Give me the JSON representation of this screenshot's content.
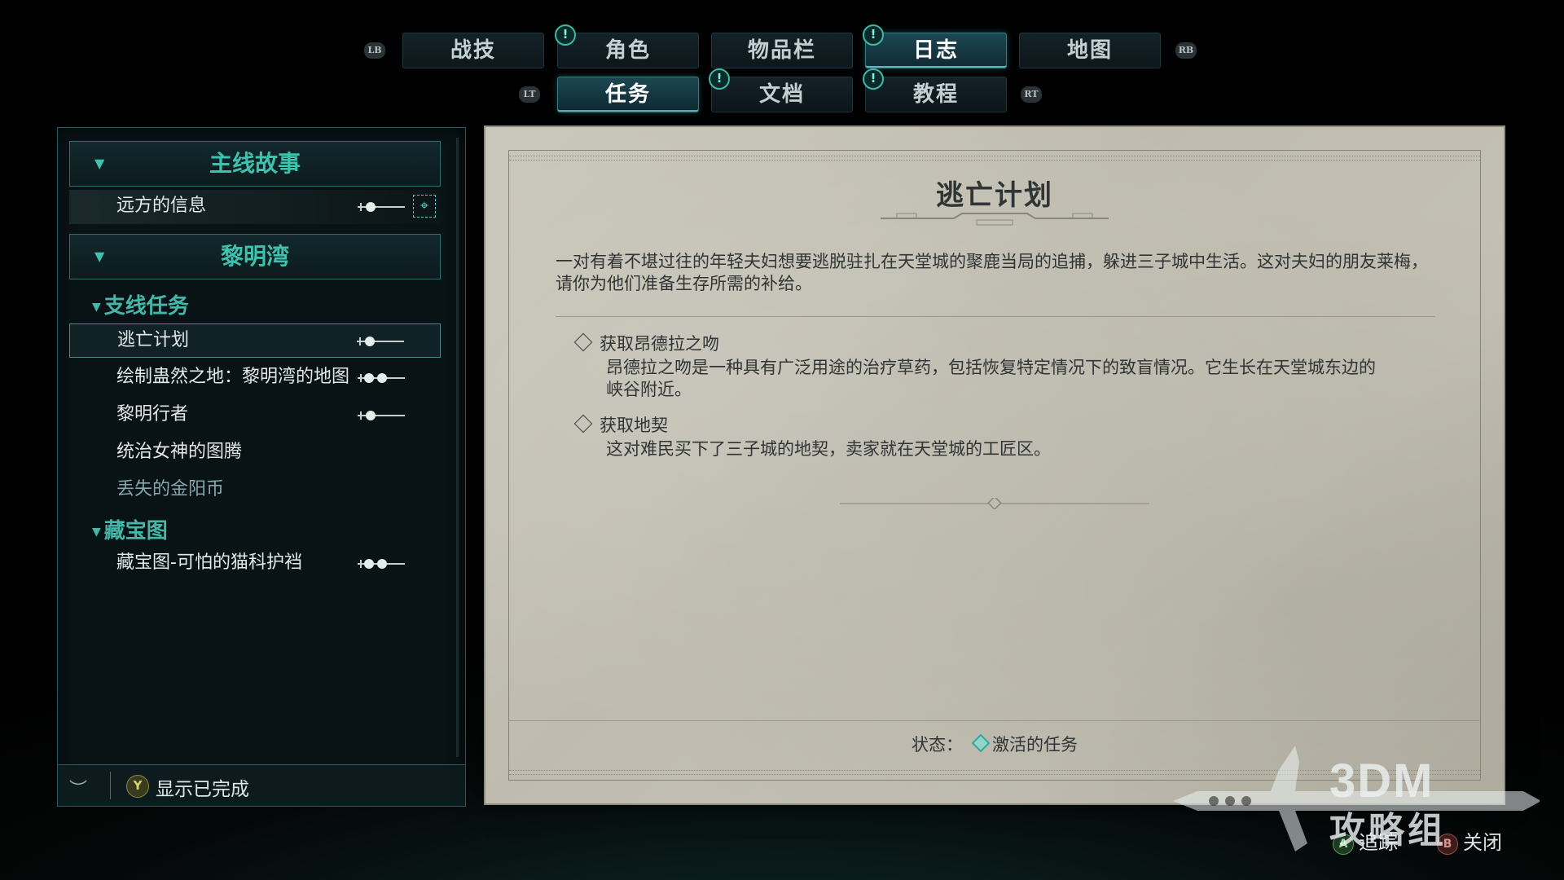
{
  "top_tabs": {
    "row1": [
      {
        "label": "战技",
        "active": false,
        "alert": false
      },
      {
        "label": "角色",
        "active": false,
        "alert": true
      },
      {
        "label": "物品栏",
        "active": false,
        "alert": false
      },
      {
        "label": "日志",
        "active": true,
        "alert": true
      },
      {
        "label": "地图",
        "active": false,
        "alert": false
      }
    ],
    "row2": [
      {
        "label": "任务",
        "active": true,
        "alert": false
      },
      {
        "label": "文档",
        "active": false,
        "alert": true
      },
      {
        "label": "教程",
        "active": false,
        "alert": true
      }
    ],
    "bumpers": {
      "lb": "LB",
      "rb": "RB",
      "lt": "LT",
      "rt": "RT"
    },
    "alert_glyph": "!"
  },
  "quest_list": {
    "groups": [
      {
        "title": "主线故事",
        "quests": [
          {
            "name": "远方的信息",
            "tracked": true,
            "difficulty": 1
          }
        ]
      },
      {
        "title": "黎明湾"
      }
    ],
    "subgroups": [
      {
        "title": "支线任务",
        "quests": [
          {
            "name": "逃亡计划",
            "selected": true,
            "difficulty": 1
          },
          {
            "name": "绘制蛊然之地：黎明湾的地图",
            "difficulty": 2
          },
          {
            "name": "黎明行者",
            "difficulty": 1
          },
          {
            "name": "统治女神的图腾",
            "difficulty": 0
          },
          {
            "name": "丢失的金阳币",
            "difficulty": 0,
            "faded": true
          }
        ]
      },
      {
        "title": "藏宝图",
        "quests": [
          {
            "name": "藏宝图-可怕的猫科护裆",
            "difficulty": 2
          }
        ]
      }
    ],
    "chevron": "▼",
    "footer": {
      "button": "Y",
      "label": "显示已完成"
    }
  },
  "detail": {
    "title": "逃亡计划",
    "description": "一对有着不堪过往的年轻夫妇想要逃脱驻扎在天堂城的聚鹿当局的追捕，躲进三子城中生活。这对夫妇的朋友莱梅，请你为他们准备生存所需的补给。",
    "objectives": [
      {
        "title": "获取昂德拉之吻",
        "body": "昂德拉之吻是一种具有广泛用途的治疗草药，包括恢复特定情况下的致盲情况。它生长在天堂城东边的峡谷附近。"
      },
      {
        "title": "获取地契",
        "body": "这对难民买下了三子城的地契，卖家就在天堂城的工匠区。"
      }
    ],
    "status_label": "状态：",
    "status_value": "激活的任务"
  },
  "hints": [
    {
      "button": "A",
      "label": "追踪"
    },
    {
      "button": "B",
      "label": "关闭"
    }
  ],
  "watermark": {
    "line1": "3DM",
    "line2": "攻略组"
  },
  "colors": {
    "accent": "#3ec1ad",
    "parchment": "#c4c1b4",
    "ink": "#2f3434",
    "status_active": "#3aa59a"
  }
}
